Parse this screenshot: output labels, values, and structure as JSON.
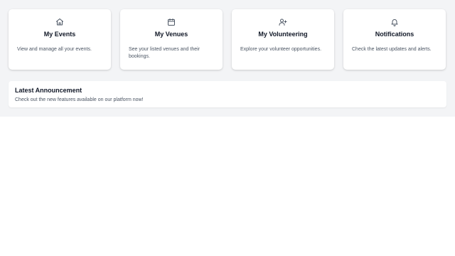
{
  "cards": [
    {
      "icon": "home-icon",
      "title": "My Events",
      "description": "View and manage all your events."
    },
    {
      "icon": "calendar-icon",
      "title": "My Venues",
      "description": "See your listed venues and their bookings."
    },
    {
      "icon": "user-plus-icon",
      "title": "My Volunteering",
      "description": "Explore your volunteer opportunities."
    },
    {
      "icon": "bell-icon",
      "title": "Notifications",
      "description": "Check the latest updates and alerts."
    }
  ],
  "announcement": {
    "title": "Latest Announcement",
    "text": "Check out the new features available on our platform now!"
  },
  "colors": {
    "background": "#f3f4f6",
    "card": "#ffffff",
    "title_text": "#111827",
    "body_text": "#4b5563",
    "icon_stroke": "#4b5563"
  }
}
